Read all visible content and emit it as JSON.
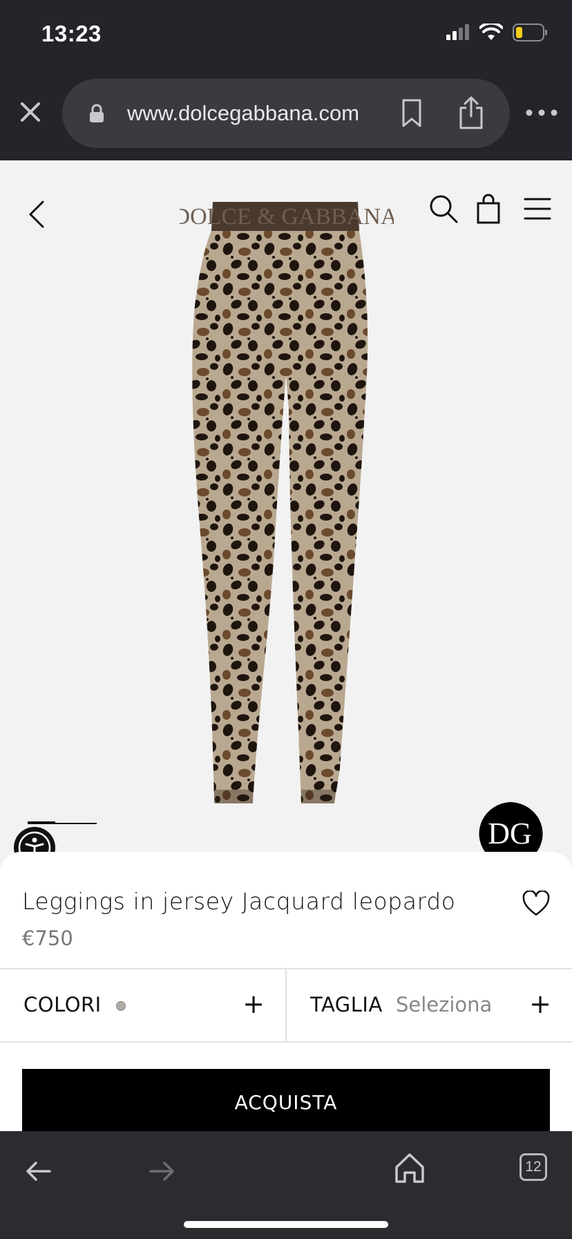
{
  "status": {
    "time": "13:23"
  },
  "browser": {
    "url": "www.dolcegabbana.com",
    "tab_count": "12"
  },
  "product": {
    "image_logo_text": "DOLCE & GABBANA",
    "title": "Leggings in jersey Jacquard leopardo",
    "price": "€750",
    "colors_label": "COLORI",
    "size_label": "TAGLIA",
    "size_value": "Seleziona",
    "plus": "+",
    "buy_label": "ACQUISTA"
  },
  "chat_badge": {
    "text": "DG"
  },
  "icons": [
    "close-icon",
    "lock-icon",
    "bookmark-icon",
    "share-icon",
    "more-icon",
    "back-icon",
    "search-icon",
    "bag-icon",
    "menu-icon",
    "heart-icon",
    "accessibility-icon",
    "arrow-left-icon",
    "arrow-right-icon",
    "home-icon",
    "tabs-icon"
  ],
  "colors": {
    "accent": "#000000",
    "browser_chrome": "#24252a",
    "page_bg": "#f2f2f2",
    "battery_level": "#f4cc1a"
  }
}
